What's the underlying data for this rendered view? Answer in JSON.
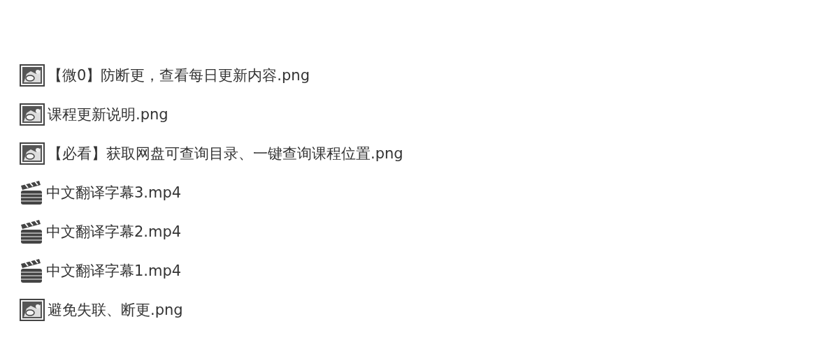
{
  "files": [
    {
      "kind": "image",
      "name": "【微0】防断更，查看每日更新内容.png"
    },
    {
      "kind": "image",
      "name": "课程更新说明.png"
    },
    {
      "kind": "image",
      "name": "【必看】获取网盘可查询目录、一键查询课程位置.png"
    },
    {
      "kind": "video",
      "name": "中文翻译字幕3.mp4"
    },
    {
      "kind": "video",
      "name": "中文翻译字幕2.mp4"
    },
    {
      "kind": "video",
      "name": "中文翻译字幕1.mp4"
    },
    {
      "kind": "image",
      "name": "避免失联、断更.png"
    }
  ]
}
